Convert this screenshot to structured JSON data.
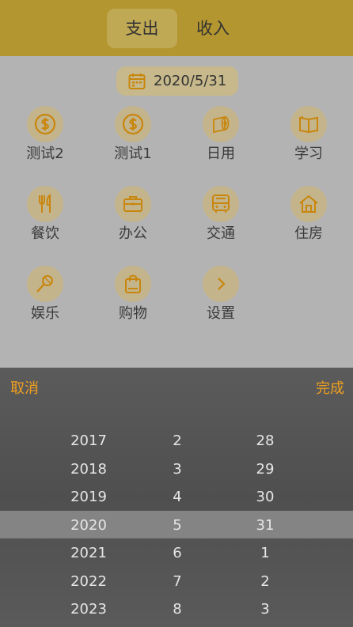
{
  "header": {
    "tabs": [
      {
        "label": "支出",
        "active": true
      },
      {
        "label": "收入",
        "active": false
      }
    ]
  },
  "date_chip": {
    "icon": "calendar-icon",
    "value": "2020/5/31"
  },
  "categories": [
    {
      "label": "测试2",
      "icon": "dollar-icon"
    },
    {
      "label": "测试1",
      "icon": "dollar-icon"
    },
    {
      "label": "日用",
      "icon": "tissue-roll-icon"
    },
    {
      "label": "学习",
      "icon": "book-icon"
    },
    {
      "label": "餐饮",
      "icon": "utensils-icon"
    },
    {
      "label": "办公",
      "icon": "briefcase-icon"
    },
    {
      "label": "交通",
      "icon": "bus-icon"
    },
    {
      "label": "住房",
      "icon": "house-icon"
    },
    {
      "label": "娱乐",
      "icon": "microphone-icon"
    },
    {
      "label": "购物",
      "icon": "shopping-bag-icon"
    },
    {
      "label": "设置",
      "icon": "chevron-right-icon"
    }
  ],
  "picker": {
    "cancel": "取消",
    "done": "完成",
    "years": [
      "2017",
      "2018",
      "2019",
      "2020",
      "2021",
      "2022",
      "2023"
    ],
    "months": [
      "2",
      "3",
      "4",
      "5",
      "6",
      "7",
      "8"
    ],
    "days": [
      "28",
      "29",
      "30",
      "31",
      "1",
      "2",
      "3"
    ],
    "selected": {
      "year": "2020",
      "month": "5",
      "day": "31"
    }
  },
  "colors": {
    "header": "#b3962f",
    "accent": "#c8860c",
    "picker_button": "#f0a020",
    "overlay": "#b3b3b3"
  }
}
